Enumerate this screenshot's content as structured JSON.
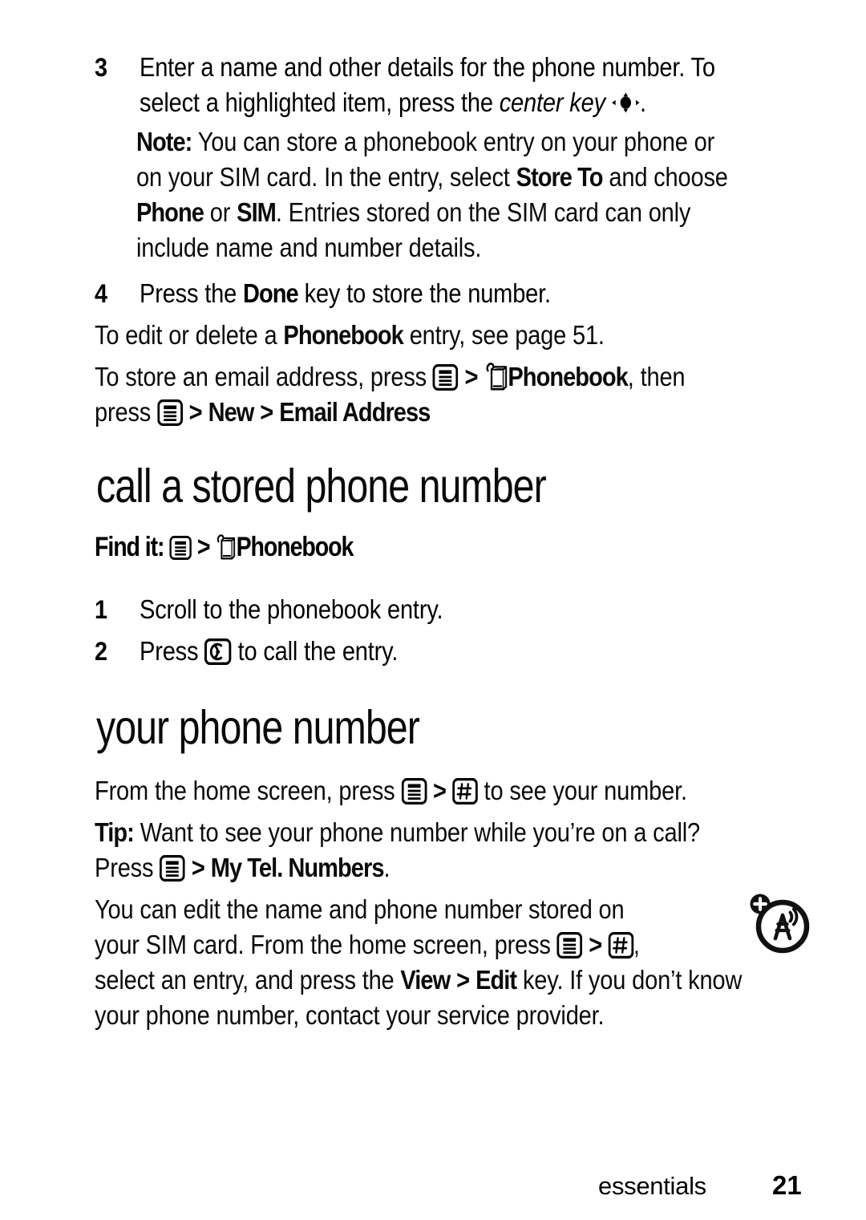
{
  "document": {
    "page_number": "21",
    "section_label": "essentials"
  },
  "steps_top": [
    {
      "number": "3",
      "lines": [
        "Enter a name and other details for the phone number. To",
        "select a highlighted item, press the "
      ],
      "italic_term": "center key",
      "trailing": "."
    },
    {
      "number": "4",
      "text_before": "Press the ",
      "bold_term": "Done",
      "text_after": " key to store the number."
    }
  ],
  "note": {
    "label": "Note:",
    "line1_after_label": " You can store a phonebook entry on your phone or",
    "line2_a": "on your SIM card. In the entry, select ",
    "line2_bold": "Store To",
    "line2_b": " and choose",
    "line3_bold1": "Phone",
    "line3_a": " or ",
    "line3_bold2": "SIM",
    "line3_b": ". Entries stored on the SIM card can only",
    "line4": "include name and number details."
  },
  "edit_delete_para": {
    "a": "To edit or delete a ",
    "bold": "Phonebook",
    "b": " entry, see page 51."
  },
  "email_para": {
    "line1_a": "To store an email address, press ",
    "line1_sep": ">",
    "line1_bold": "Phonebook",
    "line1_b": ", then",
    "line2_a": "press ",
    "line2_sep1": ">",
    "line2_bold1": "New",
    "line2_sep2": ">",
    "line2_bold2": "Email Address"
  },
  "section_call": {
    "heading": "call a stored phone number",
    "find_it_label": "Find it:",
    "find_it_sep": ">",
    "find_it_target": "Phonebook",
    "steps": [
      {
        "number": "1",
        "text": "Scroll to the phonebook entry."
      },
      {
        "number": "2",
        "text_before": "Press ",
        "text_after": " to call the entry."
      }
    ]
  },
  "section_your_number": {
    "heading": "your phone number",
    "intro_a": "From the home screen, press ",
    "intro_sep": ">",
    "intro_b": " to see your number.",
    "tip_label": "Tip:",
    "tip_line1": " Want to see your phone number while you’re on a call?",
    "tip_line2_a": "Press ",
    "tip_line2_sep": ">",
    "tip_line2_bold": "My Tel. Numbers",
    "tip_line2_b": ".",
    "body_line1": "You can edit the name and phone number stored on",
    "body_line2_a": "your SIM card. From the home screen, press ",
    "body_line2_sep": ">",
    "body_line2_b": ",",
    "body_line3_a": "select an entry, and press the ",
    "body_line3_bold1": "View",
    "body_line3_sep": ">",
    "body_line3_bold2": "Edit",
    "body_line3_b": " key. If you don’t know",
    "body_line4": "your phone number, contact your service provider."
  },
  "icons": {
    "menu": "menu-key-icon",
    "phonebook": "phonebook-icon",
    "hash": "hash-key-icon",
    "send": "send-key-icon",
    "center": "center-key-icon",
    "network_badge": "network-tower-badge-icon"
  },
  "colors": {
    "ink": "#0b0b0b",
    "paper": "#ffffff"
  }
}
